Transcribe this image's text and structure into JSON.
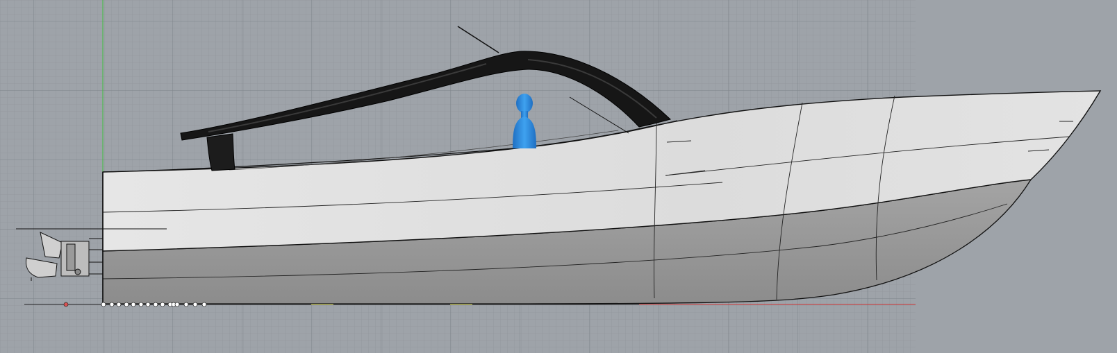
{
  "viewport": {
    "type": "cad-perspective-side-view",
    "background_color": "#9ea3a9",
    "grid_color": "#8b9096",
    "grid_major_color": "#7e838a",
    "y_axis_color": "#3fbf3f",
    "x_axis_color": "#cc3333"
  },
  "model": {
    "hull_topsides_color": "#dcdcdc",
    "hull_bottom_color": "#959595",
    "arch_color": "#161616",
    "figure_color": "#2f8fe0",
    "figure_icon": "human-figure-icon",
    "outboard_icon": "outboard-motor-icon"
  }
}
